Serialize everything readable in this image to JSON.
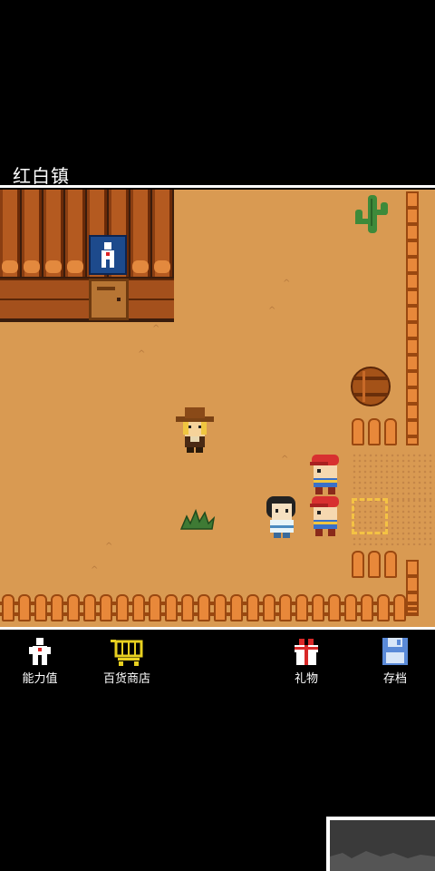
{
  "location_name": "红白镇",
  "toolbar": {
    "stats_label": "能力值",
    "shop_label": "百货商店",
    "gift_label": "礼物",
    "save_label": "存档"
  },
  "colors": {
    "ground": "#d99a52",
    "fence": "#e8883a",
    "selection": "#f4c244"
  },
  "icons": [
    "stick-figure-icon",
    "shopping-cart-icon",
    "gift-icon",
    "floppy-disk-icon"
  ]
}
